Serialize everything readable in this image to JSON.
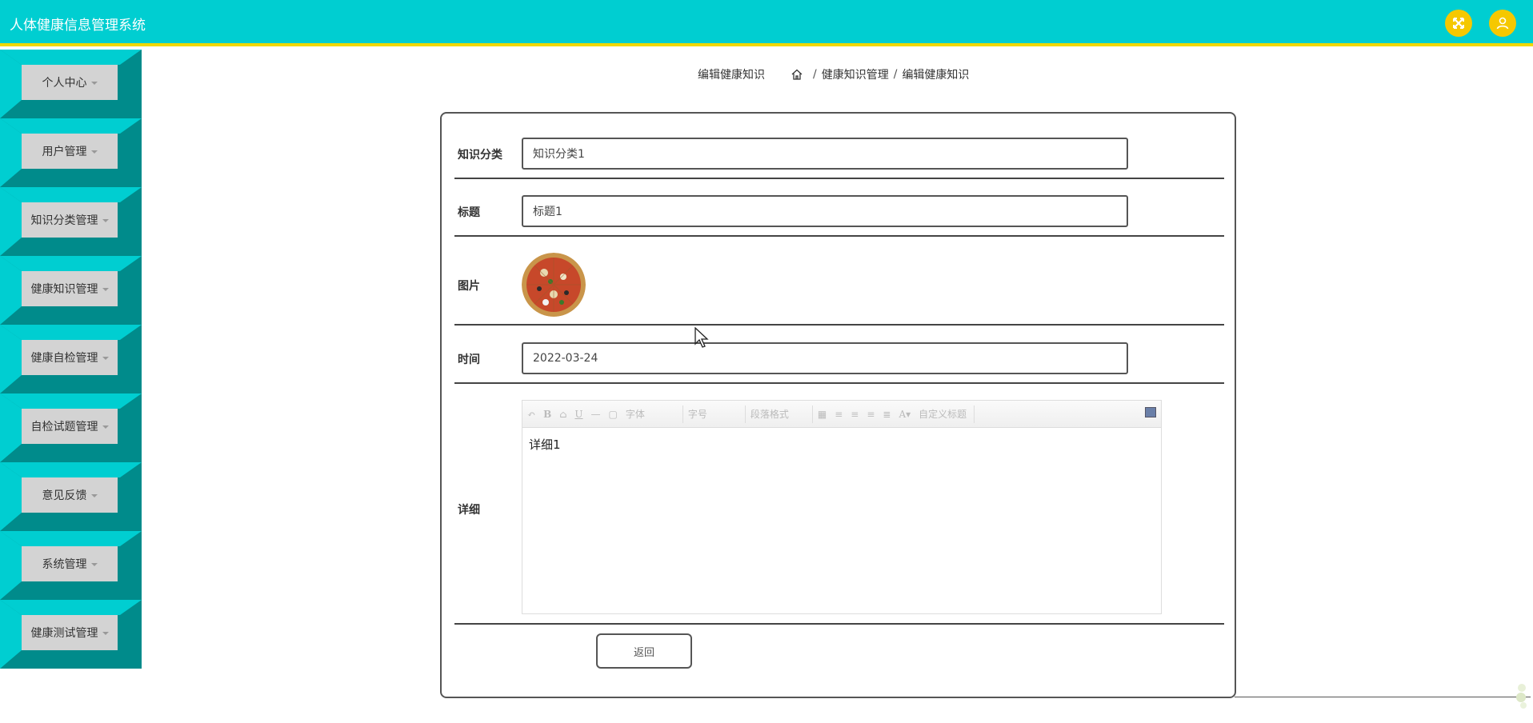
{
  "app": {
    "title": "人体健康信息管理系统"
  },
  "header": {
    "fullscreen_icon": "fullscreen-icon",
    "user_icon": "user-icon",
    "accent_color": "#00ced1",
    "button_color": "#f5c800"
  },
  "sidebar": {
    "items": [
      {
        "label": "个人中心"
      },
      {
        "label": "用户管理"
      },
      {
        "label": "知识分类管理"
      },
      {
        "label": "健康知识管理"
      },
      {
        "label": "健康自检管理"
      },
      {
        "label": "自检试题管理"
      },
      {
        "label": "意见反馈"
      },
      {
        "label": "系统管理"
      },
      {
        "label": "健康测试管理"
      }
    ]
  },
  "breadcrumb": {
    "page_title": "编辑健康知识",
    "home_icon": "home-icon",
    "level1": "健康知识管理",
    "level2": "编辑健康知识",
    "separator": "/"
  },
  "form": {
    "category": {
      "label": "知识分类",
      "value": "知识分类1"
    },
    "title": {
      "label": "标题",
      "value": "标题1"
    },
    "image": {
      "label": "图片"
    },
    "time": {
      "label": "时间",
      "value": "2022-03-24"
    },
    "detail": {
      "label": "详细",
      "content": "详细1",
      "toolbar": {
        "font_family": "字体",
        "font_size": "字号",
        "paragraph": "段落格式",
        "custom_title": "自定义标题"
      }
    },
    "back_label": "返回"
  }
}
